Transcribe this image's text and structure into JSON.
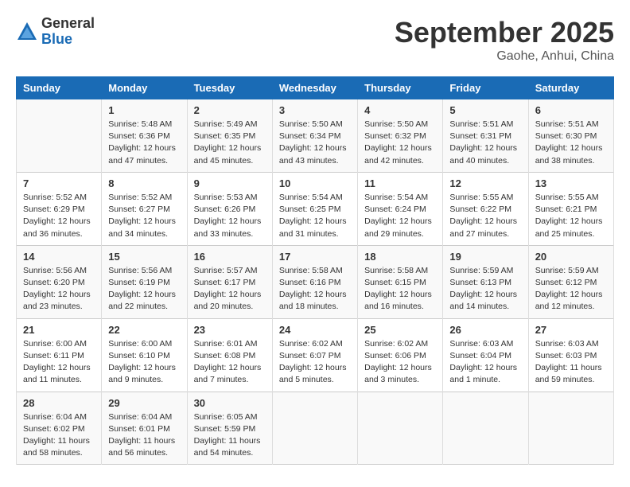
{
  "logo": {
    "general": "General",
    "blue": "Blue"
  },
  "title": "September 2025",
  "location": "Gaohe, Anhui, China",
  "days_of_week": [
    "Sunday",
    "Monday",
    "Tuesday",
    "Wednesday",
    "Thursday",
    "Friday",
    "Saturday"
  ],
  "weeks": [
    [
      {
        "day": "",
        "info": ""
      },
      {
        "day": "1",
        "info": "Sunrise: 5:48 AM\nSunset: 6:36 PM\nDaylight: 12 hours\nand 47 minutes."
      },
      {
        "day": "2",
        "info": "Sunrise: 5:49 AM\nSunset: 6:35 PM\nDaylight: 12 hours\nand 45 minutes."
      },
      {
        "day": "3",
        "info": "Sunrise: 5:50 AM\nSunset: 6:34 PM\nDaylight: 12 hours\nand 43 minutes."
      },
      {
        "day": "4",
        "info": "Sunrise: 5:50 AM\nSunset: 6:32 PM\nDaylight: 12 hours\nand 42 minutes."
      },
      {
        "day": "5",
        "info": "Sunrise: 5:51 AM\nSunset: 6:31 PM\nDaylight: 12 hours\nand 40 minutes."
      },
      {
        "day": "6",
        "info": "Sunrise: 5:51 AM\nSunset: 6:30 PM\nDaylight: 12 hours\nand 38 minutes."
      }
    ],
    [
      {
        "day": "7",
        "info": "Sunrise: 5:52 AM\nSunset: 6:29 PM\nDaylight: 12 hours\nand 36 minutes."
      },
      {
        "day": "8",
        "info": "Sunrise: 5:52 AM\nSunset: 6:27 PM\nDaylight: 12 hours\nand 34 minutes."
      },
      {
        "day": "9",
        "info": "Sunrise: 5:53 AM\nSunset: 6:26 PM\nDaylight: 12 hours\nand 33 minutes."
      },
      {
        "day": "10",
        "info": "Sunrise: 5:54 AM\nSunset: 6:25 PM\nDaylight: 12 hours\nand 31 minutes."
      },
      {
        "day": "11",
        "info": "Sunrise: 5:54 AM\nSunset: 6:24 PM\nDaylight: 12 hours\nand 29 minutes."
      },
      {
        "day": "12",
        "info": "Sunrise: 5:55 AM\nSunset: 6:22 PM\nDaylight: 12 hours\nand 27 minutes."
      },
      {
        "day": "13",
        "info": "Sunrise: 5:55 AM\nSunset: 6:21 PM\nDaylight: 12 hours\nand 25 minutes."
      }
    ],
    [
      {
        "day": "14",
        "info": "Sunrise: 5:56 AM\nSunset: 6:20 PM\nDaylight: 12 hours\nand 23 minutes."
      },
      {
        "day": "15",
        "info": "Sunrise: 5:56 AM\nSunset: 6:19 PM\nDaylight: 12 hours\nand 22 minutes."
      },
      {
        "day": "16",
        "info": "Sunrise: 5:57 AM\nSunset: 6:17 PM\nDaylight: 12 hours\nand 20 minutes."
      },
      {
        "day": "17",
        "info": "Sunrise: 5:58 AM\nSunset: 6:16 PM\nDaylight: 12 hours\nand 18 minutes."
      },
      {
        "day": "18",
        "info": "Sunrise: 5:58 AM\nSunset: 6:15 PM\nDaylight: 12 hours\nand 16 minutes."
      },
      {
        "day": "19",
        "info": "Sunrise: 5:59 AM\nSunset: 6:13 PM\nDaylight: 12 hours\nand 14 minutes."
      },
      {
        "day": "20",
        "info": "Sunrise: 5:59 AM\nSunset: 6:12 PM\nDaylight: 12 hours\nand 12 minutes."
      }
    ],
    [
      {
        "day": "21",
        "info": "Sunrise: 6:00 AM\nSunset: 6:11 PM\nDaylight: 12 hours\nand 11 minutes."
      },
      {
        "day": "22",
        "info": "Sunrise: 6:00 AM\nSunset: 6:10 PM\nDaylight: 12 hours\nand 9 minutes."
      },
      {
        "day": "23",
        "info": "Sunrise: 6:01 AM\nSunset: 6:08 PM\nDaylight: 12 hours\nand 7 minutes."
      },
      {
        "day": "24",
        "info": "Sunrise: 6:02 AM\nSunset: 6:07 PM\nDaylight: 12 hours\nand 5 minutes."
      },
      {
        "day": "25",
        "info": "Sunrise: 6:02 AM\nSunset: 6:06 PM\nDaylight: 12 hours\nand 3 minutes."
      },
      {
        "day": "26",
        "info": "Sunrise: 6:03 AM\nSunset: 6:04 PM\nDaylight: 12 hours\nand 1 minute."
      },
      {
        "day": "27",
        "info": "Sunrise: 6:03 AM\nSunset: 6:03 PM\nDaylight: 11 hours\nand 59 minutes."
      }
    ],
    [
      {
        "day": "28",
        "info": "Sunrise: 6:04 AM\nSunset: 6:02 PM\nDaylight: 11 hours\nand 58 minutes."
      },
      {
        "day": "29",
        "info": "Sunrise: 6:04 AM\nSunset: 6:01 PM\nDaylight: 11 hours\nand 56 minutes."
      },
      {
        "day": "30",
        "info": "Sunrise: 6:05 AM\nSunset: 5:59 PM\nDaylight: 11 hours\nand 54 minutes."
      },
      {
        "day": "",
        "info": ""
      },
      {
        "day": "",
        "info": ""
      },
      {
        "day": "",
        "info": ""
      },
      {
        "day": "",
        "info": ""
      }
    ]
  ]
}
